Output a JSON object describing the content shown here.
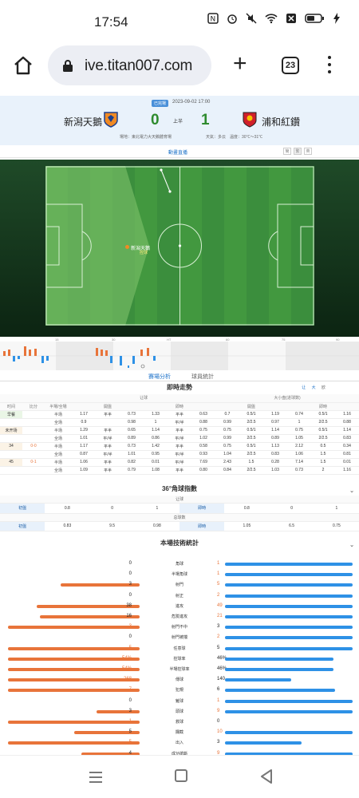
{
  "status": {
    "time": "17:54"
  },
  "browser": {
    "url": "ive.titan007.com",
    "tab_count": "23"
  },
  "match": {
    "badge": "已完場",
    "datetime": "2023-09-02 17:00",
    "home": "新潟天鵝",
    "away": "浦和紅鑽",
    "home_score": "0",
    "away_score": "1",
    "period": "上半",
    "venue": "場地：東北電力大天鵝體育場",
    "weather": "天氣：多云　溫度：30℃～31℃"
  },
  "subtabs": {
    "active": "動畫直播",
    "switches": [
      "簡",
      "繁",
      "英"
    ]
  },
  "pitch": {
    "label_team": "新潟天鵝",
    "label_action": "控球"
  },
  "timeline": {
    "marks": [
      "15",
      "30",
      "HT",
      "60",
      "75",
      "90"
    ]
  },
  "tabs": {
    "analysis": "賽場分析",
    "players": "球員統計"
  },
  "odds": {
    "title": "即時走勢",
    "filters": [
      "让",
      "大",
      "欧"
    ],
    "header_groups": [
      "让球",
      "大小盘(进球数)"
    ],
    "col_heads": [
      "时间",
      "比分",
      "半場/全場",
      "開盤",
      "即時",
      "開盤",
      "即時"
    ],
    "rows": [
      [
        "早餐",
        "",
        "半场",
        "1.17",
        "平半",
        "0.73",
        "1.33",
        "平半",
        "0.63",
        "0.7",
        "0.5/1",
        "1.19",
        "0.74",
        "0.5/1",
        "1.16"
      ],
      [
        "",
        "",
        "全场",
        "0.9",
        "",
        "0.98",
        "1",
        "平/半",
        "0.88",
        "0.99",
        "2/2.5",
        "0.97",
        "1",
        "2/2.5",
        "0.88"
      ],
      [
        "未开场",
        "",
        "半场",
        "1.29",
        "平半",
        "0.65",
        "1.14",
        "平半",
        "0.75",
        "0.75",
        "0.5/1",
        "1.14",
        "0.75",
        "0.5/1",
        "1.14"
      ],
      [
        "",
        "",
        "全场",
        "1.01",
        "平/半",
        "0.89",
        "0.86",
        "平/半",
        "1.02",
        "0.99",
        "2/2.5",
        "0.89",
        "1.05",
        "2/2.5",
        "0.83"
      ],
      [
        "34",
        "0-0",
        "半场",
        "1.17",
        "平半",
        "0.73",
        "1.42",
        "平半",
        "0.58",
        "0.75",
        "0.5/1",
        "1.13",
        "2.12",
        "0.5",
        "0.34"
      ],
      [
        "",
        "",
        "全场",
        "0.87",
        "平/半",
        "1.01",
        "0.95",
        "平/半",
        "0.93",
        "1.04",
        "2/2.5",
        "0.83",
        "1.06",
        "1.5",
        "0.81"
      ],
      [
        "45",
        "0-1",
        "半场",
        "1.06",
        "平半",
        "0.82",
        "0.01",
        "平/半",
        "7.69",
        "2.43",
        "1.5",
        "0.28",
        "7.14",
        "1.5",
        "0.01"
      ],
      [
        "",
        "",
        "全场",
        "1.09",
        "平半",
        "0.79",
        "1.08",
        "平半",
        "0.80",
        "0.84",
        "2/2.5",
        "1.03",
        "0.73",
        "2",
        "1.16"
      ]
    ]
  },
  "corner": {
    "title": "36°角球指數",
    "group1": "让球",
    "group2": "总球数",
    "row1": [
      "初盤",
      "0.8",
      "0",
      "1",
      "即時",
      "0.8",
      "0",
      "1"
    ],
    "row2": [
      "初盤",
      "0.83",
      "9.5",
      "0.98",
      "即時",
      "1.05",
      "6.5",
      "0.75"
    ]
  },
  "tech": {
    "title": "本場技術統計",
    "rows": [
      {
        "name": "角球",
        "home": "0",
        "away": "1",
        "h": 0,
        "a": 1.0
      },
      {
        "name": "半場角球",
        "home": "0",
        "away": "1",
        "h": 0,
        "a": 1.0
      },
      {
        "name": "射門",
        "home": "3",
        "away": "5",
        "h": 0.6,
        "a": 1.0
      },
      {
        "name": "射正",
        "home": "0",
        "away": "2",
        "h": 0,
        "a": 1.0
      },
      {
        "name": "進攻",
        "home": "38",
        "away": "49",
        "h": 0.78,
        "a": 1.0
      },
      {
        "name": "危險進攻",
        "home": "16",
        "away": "21",
        "h": 0.76,
        "a": 1.0
      },
      {
        "name": "射門不中",
        "home": "3",
        "away": "3",
        "h": 1.0,
        "a": 1.0
      },
      {
        "name": "射門被擋",
        "home": "0",
        "away": "2",
        "h": 0,
        "a": 1.0
      },
      {
        "name": "任意球",
        "home": "5",
        "away": "5",
        "h": 1.0,
        "a": 1.0
      },
      {
        "name": "控球率",
        "home": "54%",
        "away": "46%",
        "h": 1.0,
        "a": 0.85
      },
      {
        "name": "半場控球率",
        "home": "54%",
        "away": "46%",
        "h": 1.0,
        "a": 0.85
      },
      {
        "name": "傳球",
        "home": "268",
        "away": "140",
        "h": 1.0,
        "a": 0.52
      },
      {
        "name": "犯規",
        "home": "7",
        "away": "6",
        "h": 1.0,
        "a": 0.86
      },
      {
        "name": "鏟球",
        "home": "0",
        "away": "1",
        "h": 0,
        "a": 1.0
      },
      {
        "name": "頭球",
        "home": "3",
        "away": "9",
        "h": 0.33,
        "a": 1.0
      },
      {
        "name": "救球",
        "home": "1",
        "away": "0",
        "h": 1.0,
        "a": 0
      },
      {
        "name": "攔截",
        "home": "5",
        "away": "10",
        "h": 0.5,
        "a": 1.0
      },
      {
        "name": "出入",
        "home": "5",
        "away": "3",
        "h": 1.0,
        "a": 0.6
      },
      {
        "name": "成功搶斷",
        "home": "4",
        "away": "9",
        "h": 0.44,
        "a": 1.0
      }
    ]
  },
  "colors": {
    "home_bar": "#e8743a",
    "away_bar": "#2e91e6",
    "accent": "#1a70c8"
  }
}
